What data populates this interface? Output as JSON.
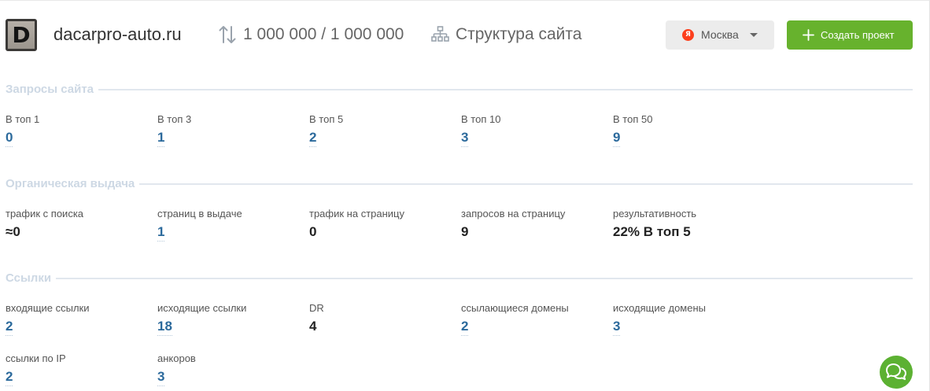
{
  "colors": {
    "link": "#2c6a9c",
    "accent": "#67b22d",
    "section_title": "#cdd8e4",
    "region_bg": "#ececec",
    "yandex": "#fc3f1d",
    "chat": "#5cb132"
  },
  "icons": {
    "limits": "sort-arrows-icon",
    "structure": "sitemap-icon",
    "region_engine": "yandex-icon",
    "region_toggle": "chevron-down-icon",
    "create": "plus-icon",
    "chat": "chat-icon"
  },
  "header": {
    "favicon_letter": "D",
    "site_name": "dacarpro-auto.ru",
    "limits": "1 000 000 / 1 000 000",
    "structure_label": "Структура сайта",
    "region": {
      "engine_letter": "Я",
      "label": "Москва"
    },
    "create_project_label": "Создать проект"
  },
  "sections": [
    {
      "title": "Запросы сайта",
      "items": [
        {
          "label": "В топ 1",
          "value": "0"
        },
        {
          "label": "В топ 3",
          "value": "1"
        },
        {
          "label": "В топ 5",
          "value": "2"
        },
        {
          "label": "В топ 10",
          "value": "3"
        },
        {
          "label": "В топ 50",
          "value": "9"
        }
      ]
    },
    {
      "title": "Органическая выдача",
      "items": [
        {
          "label": "трафик с поиска",
          "value": "≈0"
        },
        {
          "label": "страниц в выдаче",
          "value": "1"
        },
        {
          "label": "трафик на страницу",
          "value": "0"
        },
        {
          "label": "запросов на страницу",
          "value": "9"
        },
        {
          "label": "результативность",
          "value": "22% В топ 5"
        }
      ]
    },
    {
      "title": "Ссылки",
      "items": [
        {
          "label": "входящие ссылки",
          "value": "2"
        },
        {
          "label": "исходящие ссылки",
          "value": "18"
        },
        {
          "label": "DR",
          "value": "4"
        },
        {
          "label": "ссылающиеся домены",
          "value": "2"
        },
        {
          "label": "исходящие домены",
          "value": "3"
        },
        {
          "label": "ссылки по IP",
          "value": "2"
        },
        {
          "label": "анкоров",
          "value": "3"
        }
      ]
    }
  ]
}
